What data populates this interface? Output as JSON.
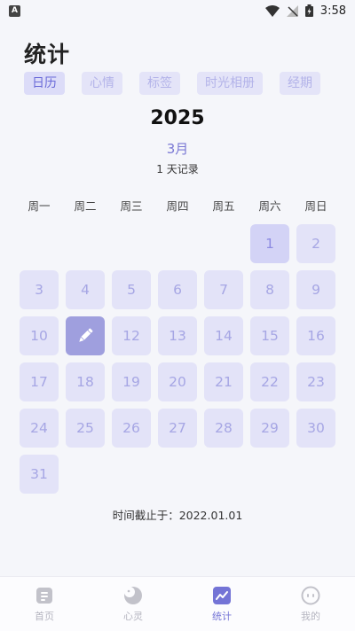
{
  "status_bar": {
    "time": "3:58"
  },
  "title": "统计",
  "tabs": [
    {
      "label": "日历",
      "active": true
    },
    {
      "label": "心情",
      "active": false
    },
    {
      "label": "标签",
      "active": false
    },
    {
      "label": "时光相册",
      "active": false
    },
    {
      "label": "经期",
      "active": false
    }
  ],
  "calendar": {
    "year": "2025",
    "month": "3月",
    "record_count": "1 天记录",
    "weekdays": [
      "周一",
      "周二",
      "周三",
      "周四",
      "周五",
      "周六",
      "周日"
    ],
    "days": [
      "",
      "",
      "",
      "",
      "",
      "1",
      "2",
      "3",
      "4",
      "5",
      "6",
      "7",
      "8",
      "9",
      "10",
      "",
      "12",
      "13",
      "14",
      "15",
      "16",
      "17",
      "18",
      "19",
      "20",
      "21",
      "22",
      "23",
      "24",
      "25",
      "26",
      "27",
      "28",
      "29",
      "30",
      "31"
    ],
    "marked_day_icon": "pen-icon"
  },
  "footer_note": "时间截止于：2022.01.01",
  "bottom_nav": [
    {
      "label": "首页",
      "icon": "home-doc-icon",
      "active": false
    },
    {
      "label": "心灵",
      "icon": "moon-icon",
      "active": false
    },
    {
      "label": "统计",
      "icon": "chart-icon",
      "active": true
    },
    {
      "label": "我的",
      "icon": "profile-face-icon",
      "active": false
    }
  ],
  "colors": {
    "accent": "#7474d6",
    "day_bg": "#e3e3f8",
    "marked_day_bg": "#9f9fde"
  }
}
